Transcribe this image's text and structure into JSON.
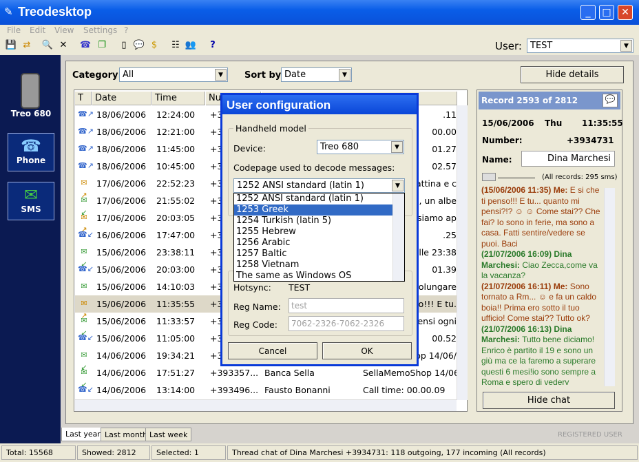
{
  "window": {
    "title": "Treodesktop"
  },
  "menu": [
    "File",
    "Edit",
    "View",
    "Settings",
    "?"
  ],
  "toolbar": {
    "user_label": "User:",
    "user_value": "TEST"
  },
  "nav": {
    "device_label": "Treo 680",
    "phone_label": "Phone",
    "sms_label": "SMS"
  },
  "filters": {
    "category_label": "Category:",
    "category_value": "All",
    "sortby_label": "Sort by:",
    "sortby_value": "Date",
    "hide_details": "Hide details"
  },
  "table": {
    "headers": [
      "T",
      "Date",
      "Time",
      "Nu",
      ""
    ],
    "rows": [
      {
        "icon": "call-outgoing",
        "date": "18/06/2006",
        "time": "12:24:00",
        "num": "+39",
        "text": ".11"
      },
      {
        "icon": "call-outgoing",
        "date": "18/06/2006",
        "time": "12:21:00",
        "num": "+39",
        "text": "00.00"
      },
      {
        "icon": "call-outgoing",
        "date": "18/06/2006",
        "time": "11:45:00",
        "num": "+39",
        "text": "01.27"
      },
      {
        "icon": "call-outgoing",
        "date": "18/06/2006",
        "time": "10:45:00",
        "num": "+39",
        "text": "02.57"
      },
      {
        "icon": "sms-outgoing",
        "date": "17/06/2006",
        "time": "22:52:23",
        "num": "+39",
        "text": "mattina e c"
      },
      {
        "icon": "sms-incoming",
        "date": "17/06/2006",
        "time": "21:55:02",
        "num": "+39",
        "text": "a, un albe"
      },
      {
        "icon": "sms-outgoing",
        "date": "17/06/2006",
        "time": "20:03:05",
        "num": "+39",
        "text": "siamo ap"
      },
      {
        "icon": "call-incoming",
        "date": "16/06/2006",
        "time": "17:47:00",
        "num": "+39",
        "text": ".25"
      },
      {
        "icon": "sms-incoming",
        "date": "15/06/2006",
        "time": "23:38:11",
        "num": "+39",
        "text": "alle 23:38"
      },
      {
        "icon": "call-incoming",
        "date": "15/06/2006",
        "time": "20:03:00",
        "num": "+39",
        "text": "01.39"
      },
      {
        "icon": "sms-incoming",
        "date": "15/06/2006",
        "time": "14:10:03",
        "num": "+39",
        "text": "rolungare"
      },
      {
        "icon": "sms-outgoing",
        "date": "15/06/2006",
        "time": "11:35:55",
        "num": "+39",
        "text": "sso!!! E tu."
      },
      {
        "icon": "sms-incoming",
        "date": "15/06/2006",
        "time": "11:33:57",
        "num": "+39",
        "text": "pensi ogni"
      },
      {
        "icon": "call-incoming",
        "date": "15/06/2006",
        "time": "11:05:00",
        "num": "+39",
        "text": "00.52"
      },
      {
        "icon": "sms-incoming",
        "date": "14/06/2006",
        "time": "19:34:21",
        "num": "+39",
        "text": "op 14/06/"
      },
      {
        "icon": "sms-incoming",
        "date": "14/06/2006",
        "time": "17:51:27",
        "num": "+393357...",
        "name": "Banca Sella",
        "text": "SellaMemoShop 14/06/"
      },
      {
        "icon": "call-incoming",
        "date": "14/06/2006",
        "time": "13:14:00",
        "num": "+393496...",
        "name": "Fausto Bonanni",
        "text": "Call time: 00.00.09"
      }
    ]
  },
  "details": {
    "record": "Record 2593 of 2812",
    "date": "15/06/2006",
    "day": "Thu",
    "time": "11:35:55",
    "number_label": "Number:",
    "number": "+3934731",
    "name_label": "Name:",
    "name": "Dina Marchesi",
    "all_records": "(All records: 295 sms)",
    "hide_chat": "Hide chat",
    "chat": [
      {
        "hdr": "(15/06/2006 11:35) Me:",
        "who": "me",
        "body": "E si che ti penso!!! E tu... quanto mi pensi?!? ☺ ☺ Come stai?? Che fai? Io sono in ferie, ma sono a casa. Fatti sentire/vedere se puoi. Baci"
      },
      {
        "hdr": "(21/07/2006 16:09) Dina Marchesi:",
        "who": "dn",
        "body": "Ciao Zecca,come va la vacanza?"
      },
      {
        "hdr": "(21/07/2006 16:11) Me:",
        "who": "me",
        "body": "Sono tornato a Rm... ☺ e fa un caldo boia!! Prima ero sotto il tuo ufficio! Come stai?? Tutto ok?"
      },
      {
        "hdr": "(21/07/2006 16:13) Dina Marchesi:",
        "who": "dn",
        "body": "Tutto bene diciamo! Enrico è partito il 19 e sono un giù ma ce la faremo a superare questi 6 mesi!io sono sempre a Roma e spero di vederv"
      }
    ]
  },
  "tabs": [
    "Last year",
    "Last month",
    "Last week"
  ],
  "registered": "REGISTERED USER",
  "status": {
    "total": "Total:  15568",
    "showed": "Showed:  2812",
    "selected": "Selected:  1",
    "thread": "Thread chat of Dina Marchesi +3934731: 118 outgoing, 177 incoming (All records)"
  },
  "dialog": {
    "title": "User configuration",
    "group_label": "Handheld model",
    "device_label": "Device:",
    "device_value": "Treo 680",
    "codepage_label": "Codepage used to decode messages:",
    "codepage_value": "1252 ANSI standard (latin 1)",
    "options": [
      "1252 ANSI standard (latin 1)",
      "1253 Greek",
      "1254 Turkish (latin 5)",
      "1255 Hebrew",
      "1256 Arabic",
      "1257 Baltic",
      "1258 Vietnam",
      "The same as Windows OS"
    ],
    "hotsync_label": "Hotsync:",
    "hotsync_value": "TEST",
    "regname_label": "Reg Name:",
    "regname_value": "test",
    "regcode_label": "Reg Code:",
    "regcode_value": "7062-2326-7062-2326",
    "cancel": "Cancel",
    "ok": "OK"
  }
}
